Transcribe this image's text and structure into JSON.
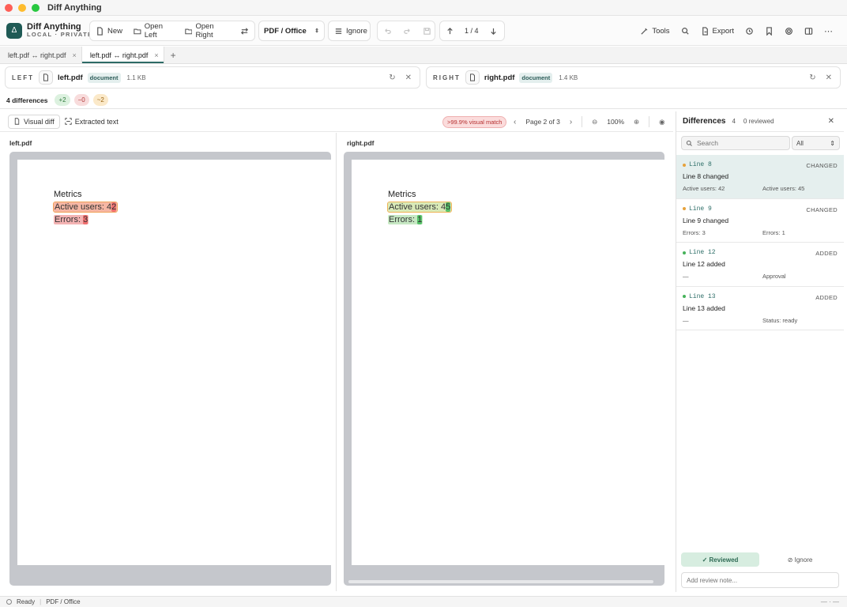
{
  "window": {
    "title": "Diff Anything"
  },
  "brand": {
    "name": "Diff Anything",
    "subtitle": "LOCAL · PRIVATE",
    "logo_icon": "delta-logo"
  },
  "toolbar": {
    "new_label": "New",
    "open_left_label": "Open Left",
    "open_right_label": "Open Right",
    "mode_select": "PDF / Office",
    "ignore_label": "Ignore",
    "pager": "1 / 4",
    "tools_label": "Tools",
    "export_label": "Export"
  },
  "tabs": [
    {
      "label": "left.pdf ↔ right.pdf",
      "active": false
    },
    {
      "label": "left.pdf ↔ right.pdf",
      "active": true
    }
  ],
  "left_file": {
    "side": "LEFT",
    "name": "left.pdf",
    "badge": "document",
    "size": "1.1 KB"
  },
  "right_file": {
    "side": "RIGHT",
    "name": "right.pdf",
    "badge": "document",
    "size": "1.4 KB"
  },
  "summary": {
    "text": "4 differences",
    "added": "+2",
    "removed": "−0",
    "changed": "~2"
  },
  "view": {
    "visual_tab": "Visual diff",
    "text_tab": "Extracted text",
    "match": ">99.9% visual match",
    "page": "Page 2 of 3",
    "zoom": "100%"
  },
  "left_pane": {
    "title": "left.pdf",
    "heading": "Metrics",
    "line1_prefix": "Active users: 4",
    "line1_char": "2",
    "line2_prefix": "Errors: ",
    "line2_char": "3"
  },
  "right_pane": {
    "title": "right.pdf",
    "heading": "Metrics",
    "line1_prefix": "Active users: 4",
    "line1_char": "5",
    "line2_prefix": "Errors: ",
    "line2_char": "1"
  },
  "differences": {
    "title": "Differences",
    "count": "4",
    "reviewed": "0 reviewed",
    "search_placeholder": "Search",
    "filter_label": "All",
    "items": [
      {
        "line": "Line 8",
        "status": "CHANGED",
        "desc": "Line 8 changed",
        "left": "Active users: 42",
        "right": "Active users: 45"
      },
      {
        "line": "Line 9",
        "status": "CHANGED",
        "desc": "Line 9 changed",
        "left": "Errors: 3",
        "right": "Errors: 1"
      },
      {
        "line": "Line 12",
        "status": "ADDED",
        "desc": "Line 12 added",
        "left": "—",
        "right": "Approval"
      },
      {
        "line": "Line 13",
        "status": "ADDED",
        "desc": "Line 13 added",
        "left": "—",
        "right": "Status: ready"
      }
    ],
    "reviewed_button": "Reviewed",
    "ignore_button": "Ignore",
    "note_placeholder": "Add review note..."
  },
  "status": {
    "state": "Ready",
    "mode": "PDF / Office",
    "right": "— · —"
  },
  "colors": {
    "accent": "#2e6b66",
    "added": "#46b25a",
    "changed": "#e6a23c",
    "removed": "#b33b3b"
  }
}
